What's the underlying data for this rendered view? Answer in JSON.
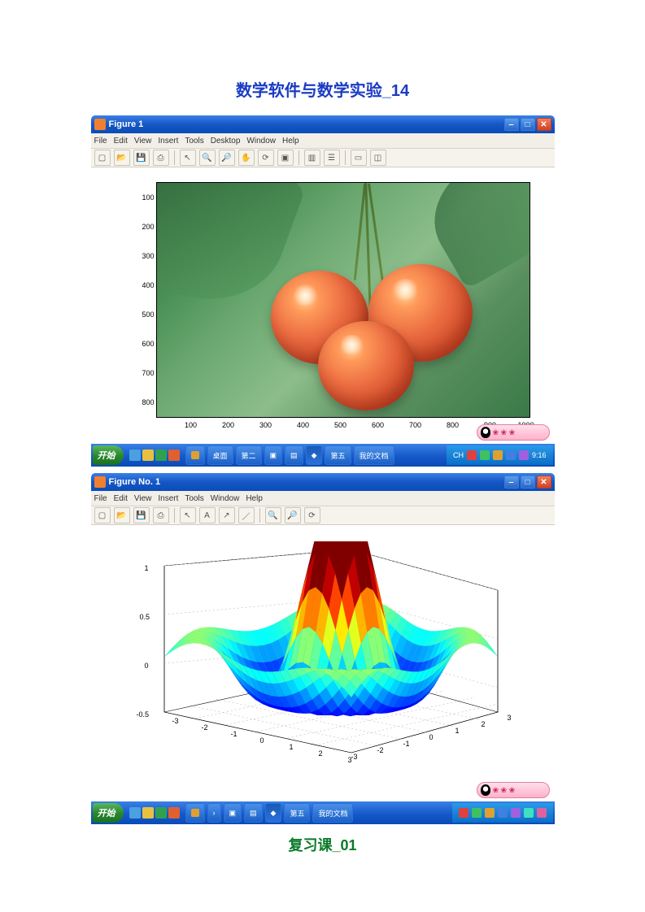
{
  "document": {
    "main_title": "数学软件与数学实验_14",
    "sub_title": "复习课_01"
  },
  "figure1": {
    "window_title": "Figure 1",
    "menu": [
      "File",
      "Edit",
      "View",
      "Insert",
      "Tools",
      "Desktop",
      "Window",
      "Help"
    ],
    "image_description": "Cherry photo displayed via imshow",
    "x_ticks": [
      "100",
      "200",
      "300",
      "400",
      "500",
      "600",
      "700",
      "800",
      "900",
      "1000"
    ],
    "y_ticks": [
      "100",
      "200",
      "300",
      "400",
      "500",
      "600",
      "700",
      "800"
    ]
  },
  "figure2": {
    "window_title": "Figure No. 1",
    "menu": [
      "File",
      "Edit",
      "View",
      "Insert",
      "Tools",
      "Window",
      "Help"
    ],
    "z_ticks": [
      "-0.5",
      "0",
      "0.5",
      "1"
    ],
    "x_ticks": [
      "-3",
      "-2",
      "-1",
      "0",
      "1",
      "2",
      "3"
    ],
    "y_ticks": [
      "-3",
      "-2",
      "-1",
      "0",
      "1",
      "2",
      "3"
    ]
  },
  "chart_data": [
    {
      "type": "heatmap",
      "title": "",
      "note": "imshow of RGB image (cherries)",
      "xlim": [
        0,
        1000
      ],
      "ylim": [
        0,
        800
      ],
      "x_ticks": [
        100,
        200,
        300,
        400,
        500,
        600,
        700,
        800,
        900,
        1000
      ],
      "y_ticks": [
        100,
        200,
        300,
        400,
        500,
        600,
        700,
        800
      ]
    },
    {
      "type": "surface",
      "title": "",
      "note": "3D surface, approx z = sin(x)*sin(y)/(x*y) style peak, jet colormap",
      "xlim": [
        -3,
        3
      ],
      "ylim": [
        -3,
        3
      ],
      "zlim": [
        -0.5,
        1
      ],
      "x_ticks": [
        -3,
        -2,
        -1,
        0,
        1,
        2,
        3
      ],
      "y_ticks": [
        -3,
        -2,
        -1,
        0,
        1,
        2,
        3
      ],
      "z_ticks": [
        -0.5,
        0,
        0.5,
        1
      ],
      "colormap": "jet"
    }
  ],
  "taskbar": {
    "start": "开始",
    "items": [
      "",
      "桌面",
      "第二",
      "",
      "",
      "",
      "第五",
      "我的文档"
    ],
    "time": "9:16",
    "tray_text": "CH"
  },
  "float_widget": "QQ"
}
